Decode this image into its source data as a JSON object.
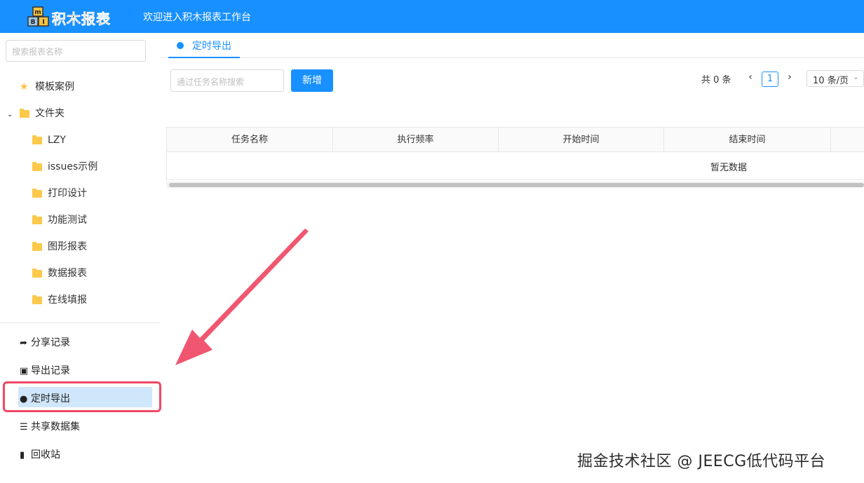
{
  "header": {
    "logo_text": "积木报表",
    "welcome": "欢迎进入积木报表工作台",
    "logo_block_letters": [
      "m",
      "B",
      "I"
    ]
  },
  "sidebar": {
    "search_placeholder": "搜索报表名称",
    "tree": [
      {
        "label": "模板案例",
        "icon": "star-icon"
      },
      {
        "label": "文件夹",
        "icon": "folder-icon",
        "expanded": true
      },
      {
        "label": "LZY",
        "icon": "folder-icon"
      },
      {
        "label": "issues示例",
        "icon": "folder-icon"
      },
      {
        "label": "打印设计",
        "icon": "folder-icon"
      },
      {
        "label": "功能测试",
        "icon": "folder-icon"
      },
      {
        "label": "图形报表",
        "icon": "folder-icon"
      },
      {
        "label": "数据报表",
        "icon": "folder-icon"
      },
      {
        "label": "在线填报",
        "icon": "folder-icon"
      }
    ],
    "menu": [
      {
        "label": "分享记录",
        "icon": "share-icon"
      },
      {
        "label": "导出记录",
        "icon": "export-icon"
      },
      {
        "label": "定时导出",
        "icon": "clock-icon",
        "active": true
      },
      {
        "label": "共享数据集",
        "icon": "database-icon"
      },
      {
        "label": "回收站",
        "icon": "trash-icon"
      }
    ]
  },
  "tab": {
    "label": "定时导出",
    "icon": "clock-icon"
  },
  "toolbar": {
    "search_placeholder": "通过任务名称搜索",
    "add_label": "新增"
  },
  "pagination": {
    "total": "共 0 条",
    "current": "1",
    "page_size": "10 条/页"
  },
  "table": {
    "columns": [
      "任务名称",
      "执行频率",
      "开始时间",
      "结束时间"
    ],
    "empty_text": "暂无数据"
  },
  "watermark": "掘金技术社区 @ JEECG低代码平台",
  "colors": {
    "primary": "#1890ff",
    "highlight": "#f04864",
    "folder": "#fcc94a"
  }
}
